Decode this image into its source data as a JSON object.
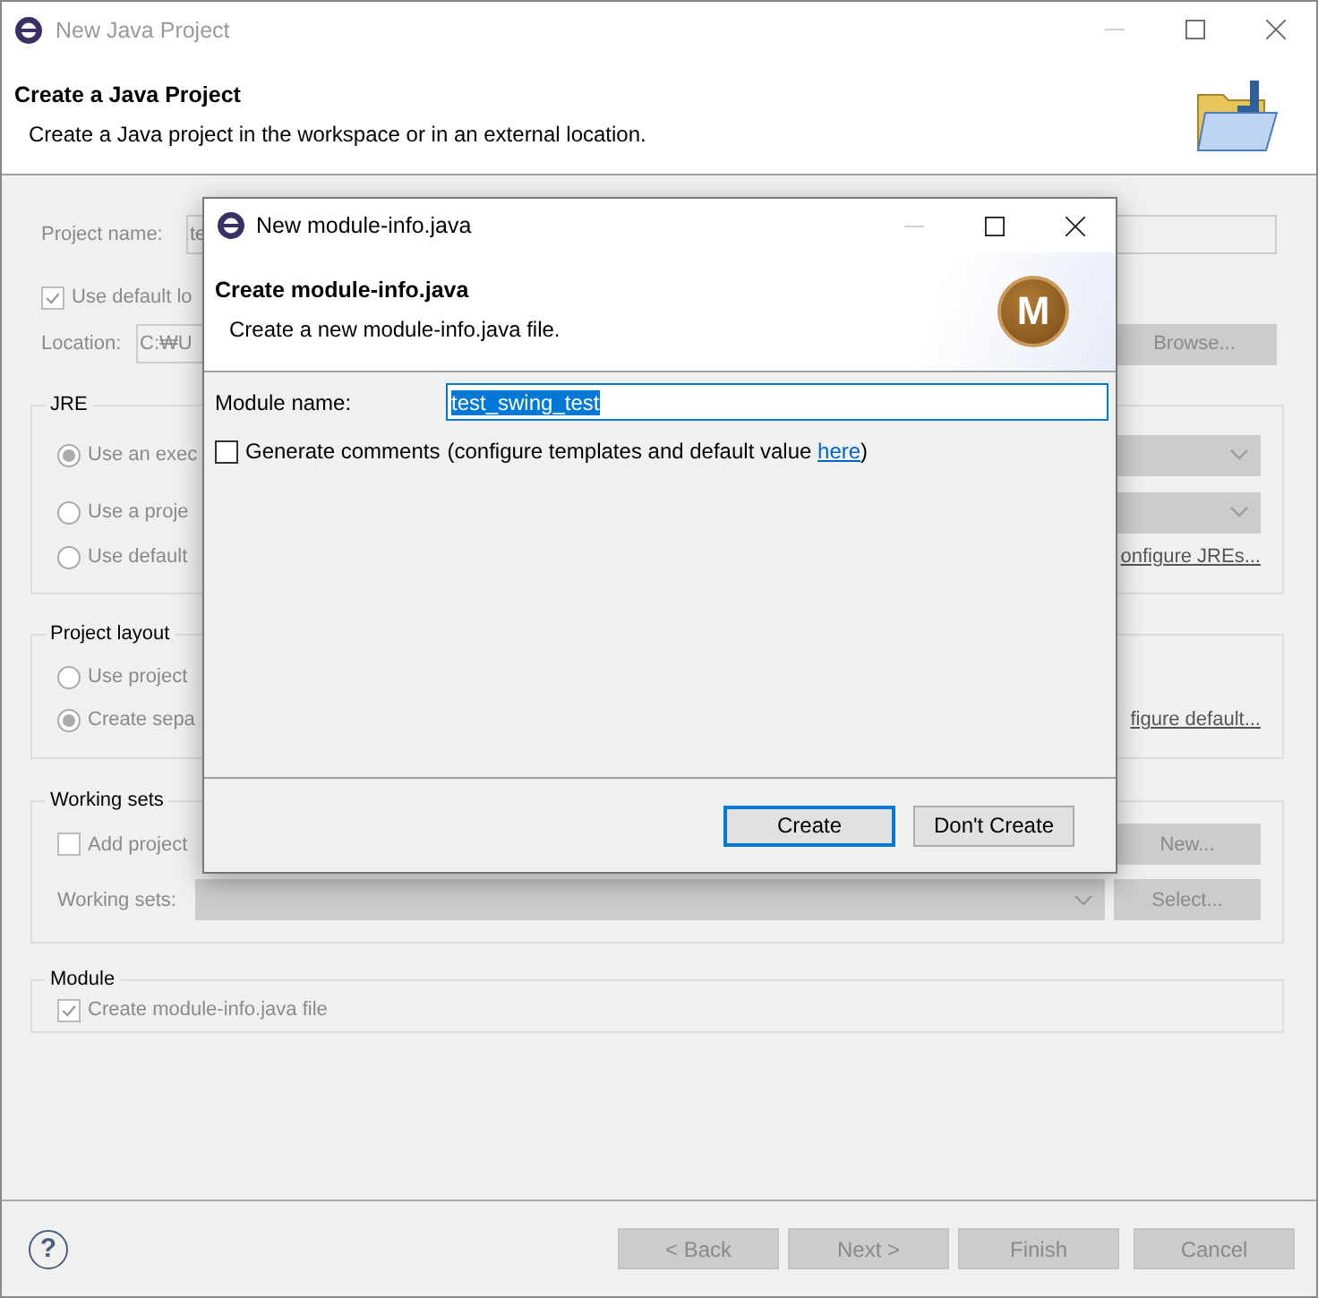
{
  "window": {
    "title": "New Java Project"
  },
  "header": {
    "title": "Create a Java Project",
    "description": "Create a Java project in the workspace or in an external location."
  },
  "form": {
    "disabled": true
  },
  "project_name": {
    "label": "Project name:",
    "value": "te"
  },
  "use_default_location": {
    "label": "Use default lo",
    "checked": true
  },
  "location": {
    "label": "Location:",
    "value": "C:₩U",
    "button": "Browse..."
  },
  "jre": {
    "title": "JRE",
    "options": [
      {
        "label": "Use an exec",
        "selected": true,
        "dropdown": true
      },
      {
        "label": "Use a proje",
        "selected": false,
        "dropdown": true
      },
      {
        "label": "Use default",
        "selected": false,
        "dropdown": false
      }
    ],
    "link": "onfigure JREs..."
  },
  "project_layout": {
    "title": "Project layout",
    "options": [
      {
        "label": "Use project",
        "selected": false
      },
      {
        "label": "Create sepa",
        "selected": true
      }
    ],
    "link": "figure default..."
  },
  "working_sets": {
    "title": "Working sets",
    "add": {
      "label": "Add project",
      "checked": false
    },
    "new_button": "New...",
    "combo_label": "Working sets:",
    "select_button": "Select..."
  },
  "module": {
    "title": "Module",
    "create": {
      "label": "Create module-info.java file",
      "checked": true
    }
  },
  "help": "?",
  "footer_buttons": [
    {
      "label": "< Back",
      "disabled": true
    },
    {
      "label": "Next >",
      "disabled": true
    },
    {
      "label": "Finish",
      "disabled": true
    },
    {
      "label": "Cancel",
      "disabled": true
    }
  ],
  "dialog": {
    "title": "New module-info.java",
    "header": {
      "title": "Create module-info.java",
      "description": "Create a new module-info.java file.",
      "badge": "M"
    },
    "module_name": {
      "label": "Module name:",
      "value": "test_swing_test",
      "selected": true
    },
    "generate_comments": {
      "label": "Generate comments",
      "checked": false,
      "note": "(configure templates and default value ",
      "link": "here",
      "note_end": ")"
    },
    "buttons": [
      {
        "label": "Create",
        "default": true
      },
      {
        "label": "Don't Create",
        "default": false
      }
    ]
  }
}
